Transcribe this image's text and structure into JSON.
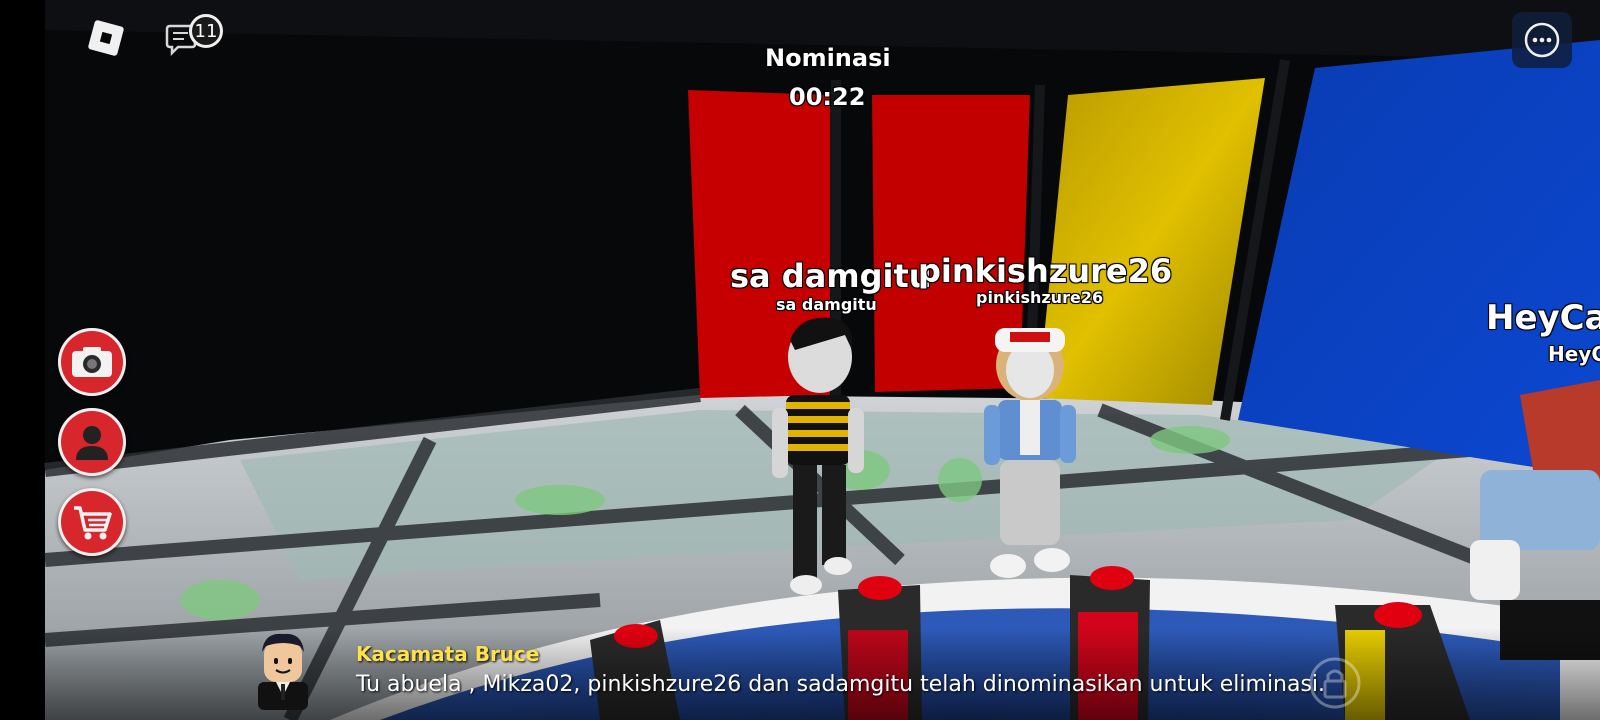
{
  "hud": {
    "chat_badge_count": "11",
    "phase_title": "Nominasi",
    "timer": "00:22"
  },
  "players": [
    {
      "display_name": "sa damgitu",
      "username": "sa damgitu"
    },
    {
      "display_name": "pinkishzure26",
      "username": "pinkishzure26"
    },
    {
      "display_name": "HeyCa",
      "username": "HeyC"
    }
  ],
  "message": {
    "speaker": "Kacamata Bruce",
    "text": "Tu abuela , Mikza02, pinkishzure26 dan sadamgitu telah dinominasikan untuk eliminasi."
  },
  "icons": {
    "roblox_logo": "roblox-logo-icon",
    "chat": "chat-icon",
    "menu": "more-menu-icon",
    "camera": "camera-icon",
    "avatar": "avatar-icon",
    "shop": "shop-cart-icon"
  },
  "colors": {
    "speaker_name": "#ffe14a",
    "button_red": "#d7262c",
    "panel_red": "#c10000",
    "panel_yellow": "#c9a400",
    "panel_blue": "#0b3fb8"
  }
}
